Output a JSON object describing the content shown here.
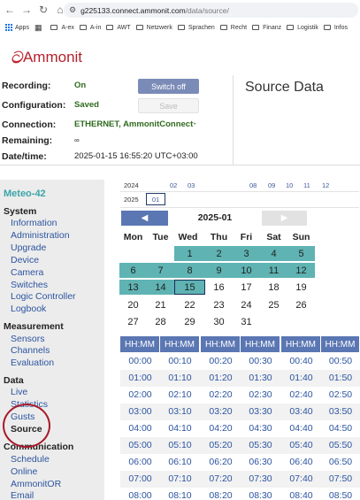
{
  "browser": {
    "url_host": "g225133.connect.ammonit.com",
    "url_path": "/data/source/",
    "bookmarks": [
      "Apps",
      "A-ex",
      "A-in",
      "AWT",
      "Netzwerk",
      "Sprachen",
      "Recht",
      "Finanz",
      "Logistik",
      "Infos"
    ]
  },
  "logo": {
    "text": "Ammonit"
  },
  "status": {
    "recording_label": "Recording:",
    "recording_value": "On",
    "configuration_label": "Configuration:",
    "configuration_value": "Saved",
    "connection_label": "Connection:",
    "connection_value": "ETHERNET, AmmonitConnect",
    "connection_suffix": "+",
    "remaining_label": "Remaining:",
    "remaining_value": "∞",
    "datetime_label": "Date/time:",
    "datetime_value": "2025-01-15 16:55:20 UTC+03:00",
    "switch_off_button": "Switch off",
    "save_button": "Save"
  },
  "page_title": "Source Data",
  "sidebar": {
    "station": "Meteo-42",
    "sections": [
      {
        "title": "System",
        "items": [
          "Information",
          "Administration",
          "Upgrade",
          "Device",
          "Camera",
          "Switches",
          "Logic Controller",
          "Logbook"
        ]
      },
      {
        "title": "Measurement",
        "items": [
          "Sensors",
          "Channels",
          "Evaluation"
        ]
      },
      {
        "title": "Data",
        "items": [
          "Live",
          "Statistics",
          "Gusts",
          "Source"
        ]
      },
      {
        "title": "Communication",
        "items": [
          "Schedule",
          "Online",
          "AmmonitOR",
          "Email"
        ]
      }
    ],
    "active_item": "Source"
  },
  "year_selector": {
    "year_2024": "2024",
    "months_2024": [
      "02",
      "03",
      "08",
      "09",
      "10",
      "11",
      "12"
    ],
    "year_2025": "2025",
    "months_2025": [
      "01"
    ],
    "selected_month": "01"
  },
  "calendar": {
    "title": "2025-01",
    "prev_icon": "◀",
    "next_icon": "▶",
    "weekdays": [
      "Mon",
      "Tue",
      "Wed",
      "Thu",
      "Fri",
      "Sat",
      "Sun"
    ],
    "weeks": [
      [
        "",
        "",
        "1",
        "2",
        "3",
        "4",
        "5"
      ],
      [
        "6",
        "7",
        "8",
        "9",
        "10",
        "11",
        "12"
      ],
      [
        "13",
        "14",
        "15",
        "16",
        "17",
        "18",
        "19"
      ],
      [
        "20",
        "21",
        "22",
        "23",
        "24",
        "25",
        "26"
      ],
      [
        "27",
        "28",
        "29",
        "30",
        "31",
        "",
        ""
      ]
    ],
    "days_with_data": [
      "1",
      "2",
      "3",
      "4",
      "5",
      "6",
      "7",
      "8",
      "9",
      "10",
      "11",
      "12",
      "13",
      "14",
      "15"
    ],
    "selected_day": "15"
  },
  "time_grid": {
    "header": [
      "HH:MM",
      "HH:MM",
      "HH:MM",
      "HH:MM",
      "HH:MM",
      "HH:MM"
    ],
    "rows": [
      [
        "00:00",
        "00:10",
        "00:20",
        "00:30",
        "00:40",
        "00:50"
      ],
      [
        "01:00",
        "01:10",
        "01:20",
        "01:30",
        "01:40",
        "01:50"
      ],
      [
        "02:00",
        "02:10",
        "02:20",
        "02:30",
        "02:40",
        "02:50"
      ],
      [
        "03:00",
        "03:10",
        "03:20",
        "03:30",
        "03:40",
        "03:50"
      ],
      [
        "04:00",
        "04:10",
        "04:20",
        "04:30",
        "04:40",
        "04:50"
      ],
      [
        "05:00",
        "05:10",
        "05:20",
        "05:30",
        "05:40",
        "05:50"
      ],
      [
        "06:00",
        "06:10",
        "06:20",
        "06:30",
        "06:40",
        "06:50"
      ],
      [
        "07:00",
        "07:10",
        "07:20",
        "07:30",
        "07:40",
        "07:50"
      ],
      [
        "08:00",
        "08:10",
        "08:20",
        "08:30",
        "08:40",
        "08:50"
      ]
    ]
  },
  "colors": {
    "brand_red": "#b3212b",
    "accent_blue": "#5b77b3",
    "data_teal": "#5fb3b3",
    "link_blue": "#2c54a0"
  }
}
